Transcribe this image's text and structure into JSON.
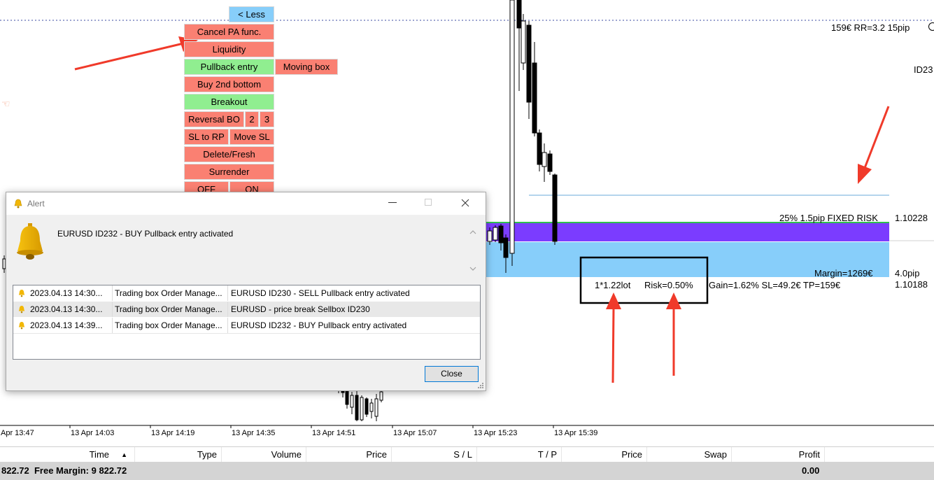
{
  "panel": {
    "less": "< Less",
    "cancel_pa": "Cancel PA func.",
    "liquidity": "Liquidity",
    "pullback_entry": "Pullback entry",
    "moving_box": "Moving box",
    "buy_2nd_bottom": "Buy 2nd bottom",
    "breakout": "Breakout",
    "reversal_bo": "Reversal BO",
    "num2": "2",
    "num3": "3",
    "sl_to_rp": "SL to RP",
    "move_sl": "Move SL",
    "delete_fresh": "Delete/Fresh",
    "surrender": "Surrender",
    "off": "OFF",
    "on": "ON"
  },
  "chart": {
    "tp_label": "159€  RR=3.2  15pip",
    "id_label": "ID23",
    "risk_label": "25% 1.5pip FIXED RISK",
    "price_top": "1.10228",
    "margin_label": "Margin=1269€",
    "pip_label": "4.0pip",
    "lot_label": "1*1.22lot",
    "risk_pct": "Risk=0.50%",
    "gain_label": "Gain=1.62%  SL=49.2€  TP=159€",
    "price_bottom": "1.10188",
    "time_labels": [
      "Apr 13:47",
      "13 Apr 14:03",
      "13 Apr 14:19",
      "13 Apr 14:35",
      "13 Apr 14:51",
      "13 Apr 15:07",
      "13 Apr 15:23",
      "13 Apr 15:39"
    ]
  },
  "alert": {
    "title": "Alert",
    "message": "EURUSD ID232 - BUY Pullback entry activated",
    "rows": [
      {
        "time": "2023.04.13 14:30...",
        "source": "Trading box Order Manage...",
        "text": "EURUSD ID230 - SELL Pullback entry activated"
      },
      {
        "time": "2023.04.13 14:30...",
        "source": "Trading box Order Manage...",
        "text": "EURUSD - price break Sellbox ID230"
      },
      {
        "time": "2023.04.13 14:39...",
        "source": "Trading box Order Manage...",
        "text": "EURUSD ID232 - BUY Pullback entry activated"
      }
    ],
    "close": "Close"
  },
  "terminal": {
    "columns": [
      "Time",
      "Type",
      "Volume",
      "Price",
      "S / L",
      "T / P",
      "Price",
      "Swap",
      "Profit"
    ],
    "footer_left": "822.72  Free Margin: 9 822.72",
    "footer_profit": "0.00"
  },
  "colors": {
    "sell_box": "#7b3cff",
    "buy_box": "#87cefa",
    "annotation_arrow": "#f03a2a",
    "button_red": "#fa8072",
    "button_green": "#90ee90"
  }
}
